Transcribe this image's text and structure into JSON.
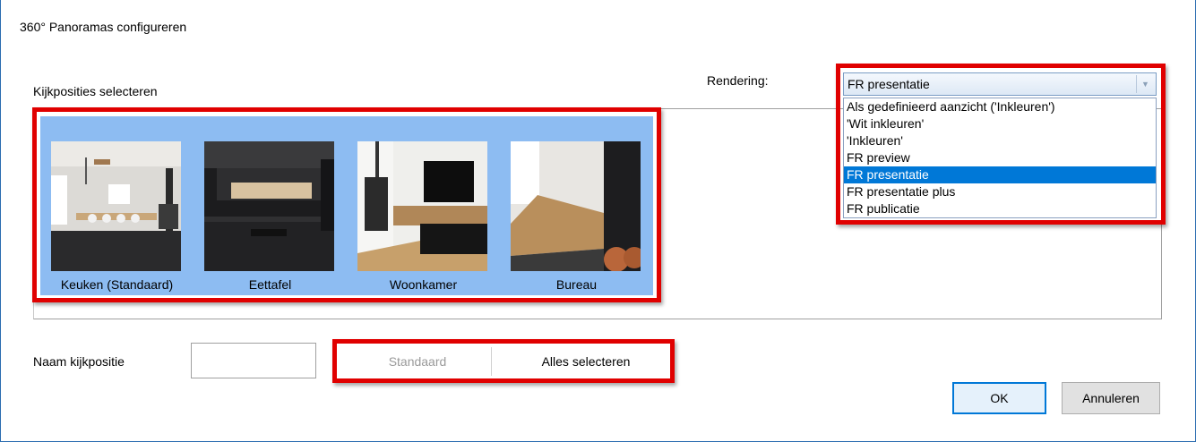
{
  "window": {
    "title": "360° Panoramas configureren"
  },
  "views": {
    "label": "Kijkposities selecteren",
    "items": [
      {
        "label": "Keuken (Standaard)"
      },
      {
        "label": "Eettafel"
      },
      {
        "label": "Woonkamer"
      },
      {
        "label": "Bureau"
      }
    ]
  },
  "rendering": {
    "label": "Rendering:",
    "selected": "FR presentatie",
    "options": [
      "Als gedefinieerd aanzicht ('Inkleuren')",
      "'Wit inkleuren'",
      "'Inkleuren'",
      "FR preview",
      "FR presentatie",
      "FR presentatie plus",
      "FR publicatie"
    ]
  },
  "name": {
    "label": "Naam kijkpositie",
    "value": ""
  },
  "buttons": {
    "standard": "Standaard",
    "select_all": "Alles selecteren",
    "ok": "OK",
    "cancel": "Annuleren"
  },
  "colors": {
    "highlight": "#e00000",
    "tile_selected": "#8dbcf2",
    "option_selected": "#0078d7"
  }
}
